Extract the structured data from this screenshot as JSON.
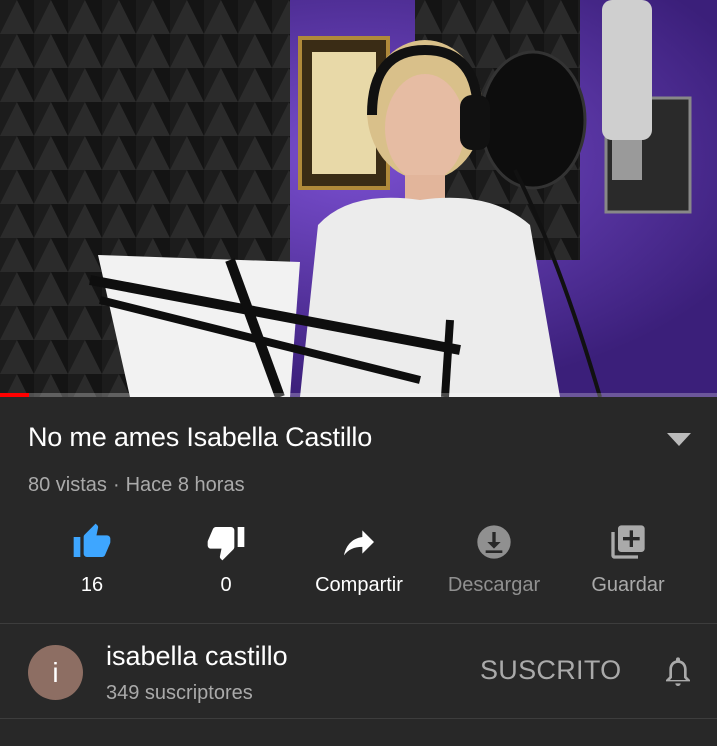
{
  "player": {
    "progress_fraction": 0.04,
    "progress_color": "#ff0000"
  },
  "video": {
    "title": "No me ames Isabella Castillo",
    "views": "80 vistas",
    "separator": "·",
    "posted": "Hace 8 horas"
  },
  "actions": [
    {
      "icon": "thumbs-up-icon",
      "label": "16",
      "color": "#3ea6ff",
      "active": true
    },
    {
      "icon": "thumbs-down-icon",
      "label": "0",
      "color": "#ffffff",
      "active": false
    },
    {
      "icon": "share-icon",
      "label": "Compartir",
      "color": "#ffffff",
      "active": false
    },
    {
      "icon": "download-icon",
      "label": "Descargar",
      "color": "#909090",
      "active": false
    },
    {
      "icon": "playlist-add-icon",
      "label": "Guardar",
      "color": "#aaaaaa",
      "active": false
    }
  ],
  "channel": {
    "avatar_letter": "i",
    "avatar_color": "#8d6e63",
    "name": "isabella castillo",
    "subscribers": "349 suscriptores",
    "subscribe_state": "SUSCRITO"
  },
  "colors": {
    "background": "#282828",
    "secondary_text": "#aaaaaa",
    "accent": "#3ea6ff"
  }
}
